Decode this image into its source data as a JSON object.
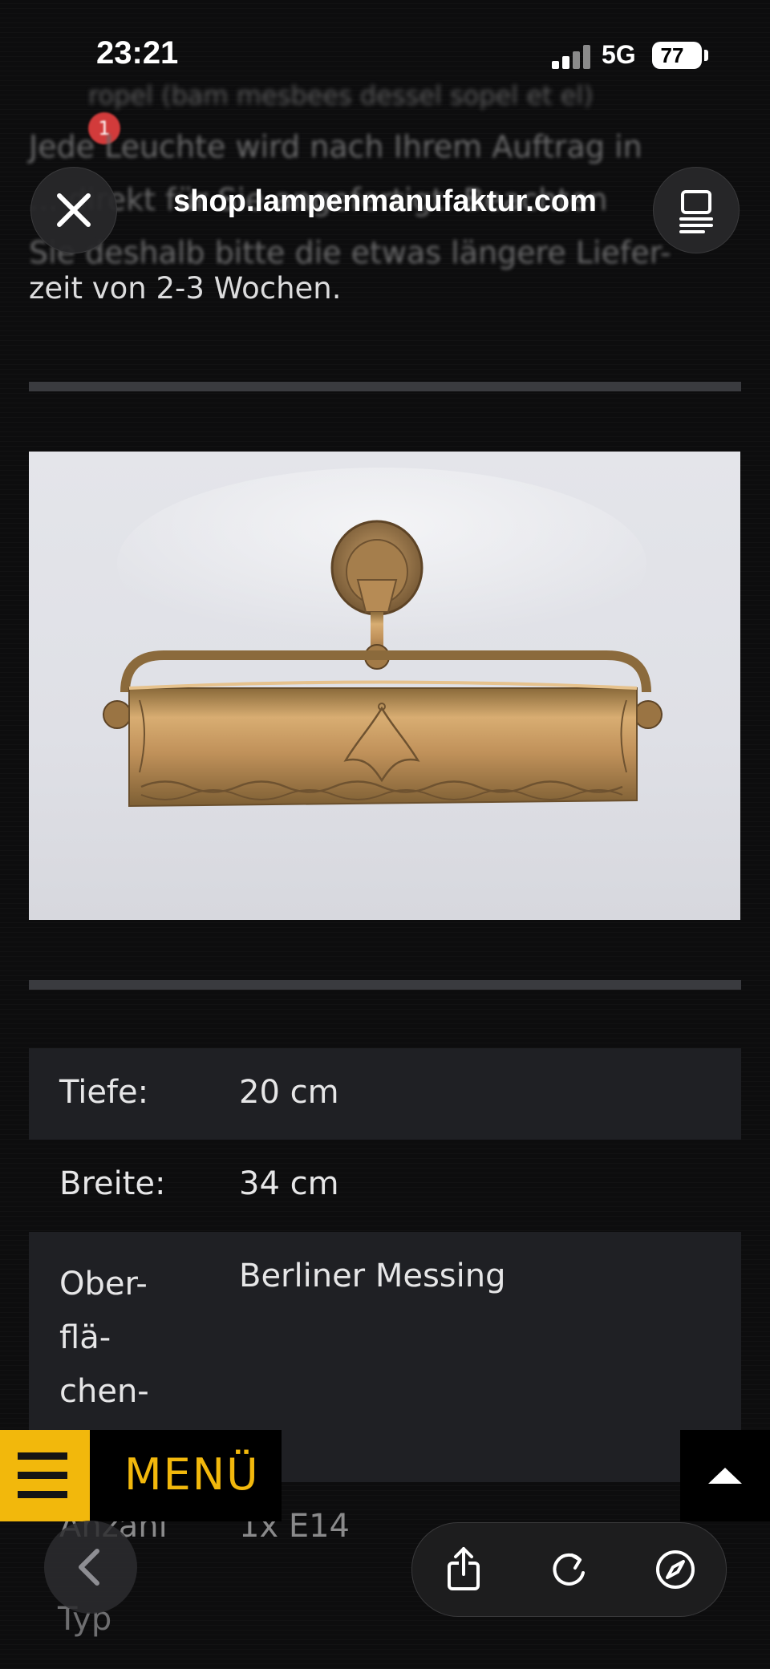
{
  "status_bar": {
    "time": "23:21",
    "network": "5G",
    "battery": "77"
  },
  "background": {
    "blurred_top": "ropel (bam mesbees dessel sopel et el)",
    "notification_count": "1",
    "lines": [
      "Jede Leuchte wird nach Ihrem Auftrag in",
      "... direkt für Sie angefertigt. Beachten",
      "Sie deshalb bitte die etwas längere Liefer-"
    ]
  },
  "browser": {
    "url": "shop.lampenmanufaktur.com"
  },
  "page": {
    "delivery_text": "zeit von 2-3 Wochen.",
    "specs": [
      {
        "label": "Tiefe:",
        "value": "20 cm"
      },
      {
        "label": "Breite:",
        "value": "34 cm"
      },
      {
        "label": "Ober-\nflä-\nchen-\nfarbe:",
        "value": "Berliner Messing"
      }
    ],
    "faded_label": "Anzahl",
    "faded_value": "1x E14",
    "faded_label2": "Typ"
  },
  "menu": {
    "label": "MENÜ"
  },
  "colors": {
    "accent": "#f2b80c",
    "row_dark": "#1f2024",
    "background": "#0d0d0e"
  },
  "icons": [
    "close-icon",
    "reader-icon",
    "menu-icon",
    "scroll-top-icon",
    "back-icon",
    "share-icon",
    "reload-icon",
    "compass-icon"
  ]
}
